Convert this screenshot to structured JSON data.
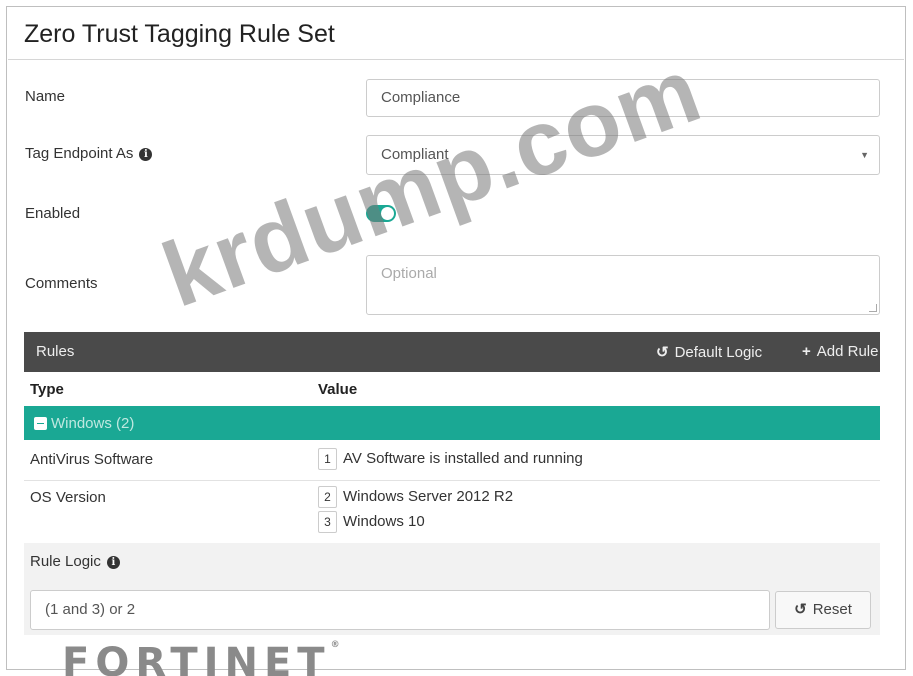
{
  "page": {
    "title": "Zero Trust Tagging Rule Set"
  },
  "form": {
    "name_label": "Name",
    "name_value": "Compliance",
    "tag_label": "Tag Endpoint As",
    "tag_value": "Compliant",
    "enabled_label": "Enabled",
    "enabled": true,
    "comments_label": "Comments",
    "comments_placeholder": "Optional"
  },
  "rules": {
    "title": "Rules",
    "default_logic_label": "Default Logic",
    "add_rule_label": "Add Rule",
    "columns": [
      "Type",
      "Value"
    ],
    "group": {
      "label": "Windows (2)"
    },
    "rows": [
      {
        "type": "AntiVirus Software",
        "values": [
          {
            "num": "1",
            "text": "AV Software is installed and running"
          }
        ]
      },
      {
        "type": "OS Version",
        "values": [
          {
            "num": "2",
            "text": "Windows Server 2012 R2"
          },
          {
            "num": "3",
            "text": "Windows 10"
          }
        ]
      }
    ]
  },
  "logic": {
    "label": "Rule Logic",
    "value": "(1 and 3) or 2",
    "reset_label": "Reset"
  },
  "watermark": "krdump.com",
  "logo": "FORTINET",
  "colors": {
    "accent": "#1aa894",
    "bar": "#4a4a4a"
  }
}
